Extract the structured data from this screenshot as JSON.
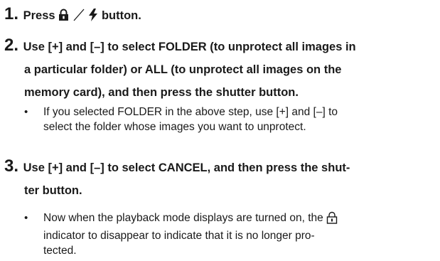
{
  "step1": {
    "number": "1.",
    "text_before": "Press",
    "icons": [
      "lock-icon",
      "slash-icon",
      "flash-icon"
    ],
    "text_after": "button."
  },
  "step2": {
    "number": "2.",
    "line1": "Use [+] and [–] to select FOLDER (to unprotect all images in",
    "line2": "a particular folder) or ALL (to unprotect all images on the",
    "line3": "memory card), and then press the shutter button.",
    "bullet_line1": "If you selected FOLDER in the above step, use [+] and [–] to",
    "bullet_line2": "select the folder whose images you want to unprotect."
  },
  "step3": {
    "number": "3.",
    "line1": "Use [+] and [–] to select CANCEL, and then press the shut-",
    "line2": "ter button.",
    "bullet_line1": "Now when the playback mode displays are turned on, the",
    "bullet_icon": "lock-icon",
    "bullet_line2": "indicator to disappear to indicate that it is no longer pro-",
    "bullet_line3": "tected."
  },
  "bullet_symbol": "•"
}
